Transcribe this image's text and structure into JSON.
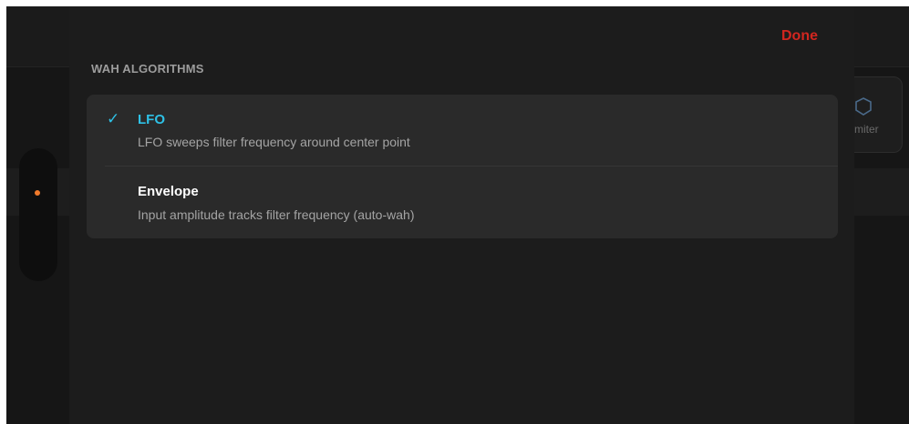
{
  "background": {
    "card_label": "miter",
    "card_icon": "shield-icon",
    "indicator_color": "#f07a2c"
  },
  "sheet": {
    "done_label": "Done",
    "section_header": "WAH ALGORITHMS",
    "options": [
      {
        "title": "LFO",
        "description": "LFO sweeps filter frequency around center point",
        "selected": true
      },
      {
        "title": "Envelope",
        "description": "Input amplitude tracks filter frequency (auto-wah)",
        "selected": false
      }
    ]
  },
  "colors": {
    "accent_selected": "#2ec1e6",
    "done": "#d2261f",
    "title_default": "#ffffff"
  }
}
